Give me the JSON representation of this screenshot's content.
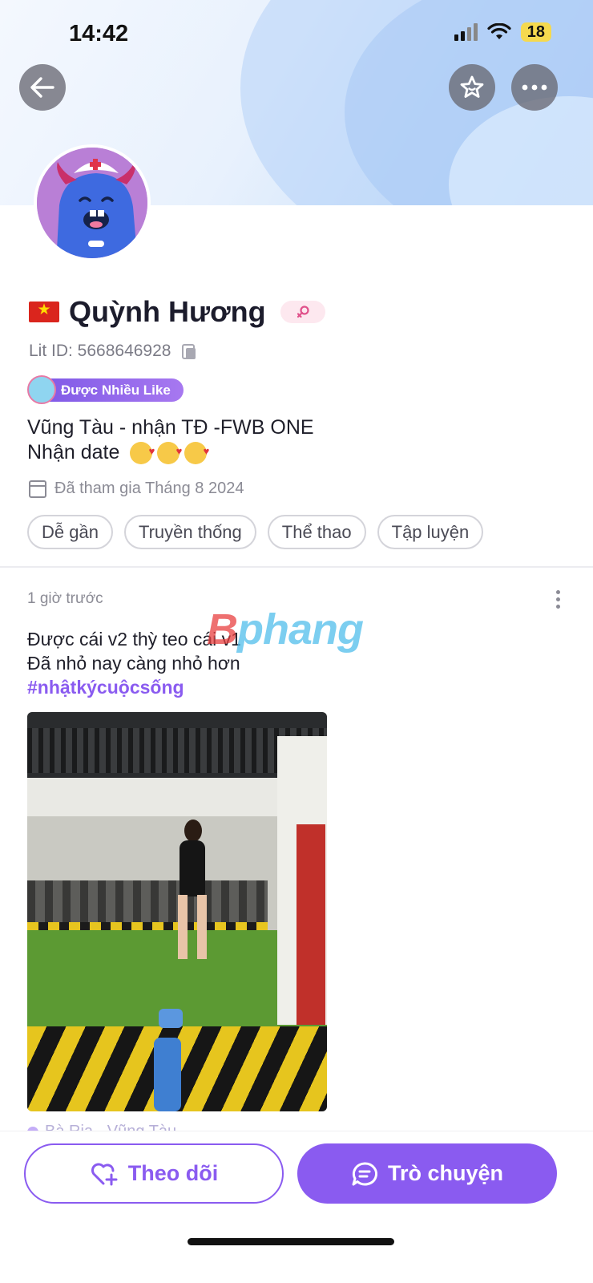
{
  "status_bar": {
    "time": "14:42",
    "battery": "18"
  },
  "header": {
    "back_icon": "back-arrow-icon",
    "favorite_icon": "star-icon",
    "more_icon": "more-dots-icon"
  },
  "profile": {
    "flag": "vietnam-flag",
    "name": "Quỳnh Hương",
    "gender_icon": "female-icon",
    "lit_id": "Lit ID: 5668646928",
    "badge": "Được Nhiều Like",
    "bio_line1": "Vũng Tàu - nhận TĐ -FWB ONE",
    "bio_line2": "Nhận date",
    "joined": "Đã tham gia Tháng 8 2024",
    "tags": [
      "Dễ gần",
      "Truyền thống",
      "Thể thao",
      "Tập luyện"
    ]
  },
  "post": {
    "time": "1 giờ trước",
    "line1": "Được cái v2 thỳ teo cái v1",
    "line2": "Đã nhỏ nay càng nhỏ hơn",
    "hashtag": "#nhậtkýcuộcsống",
    "location_peek": "Bà Rịa - Vũng Tàu"
  },
  "watermark": {
    "first": "B",
    "rest": "phang"
  },
  "actions": {
    "follow_label": "Theo dõi",
    "chat_label": "Trò chuyện"
  },
  "colors": {
    "accent": "#8a5bf0",
    "badge_start": "#7c57e6",
    "badge_end": "#a778f0"
  }
}
